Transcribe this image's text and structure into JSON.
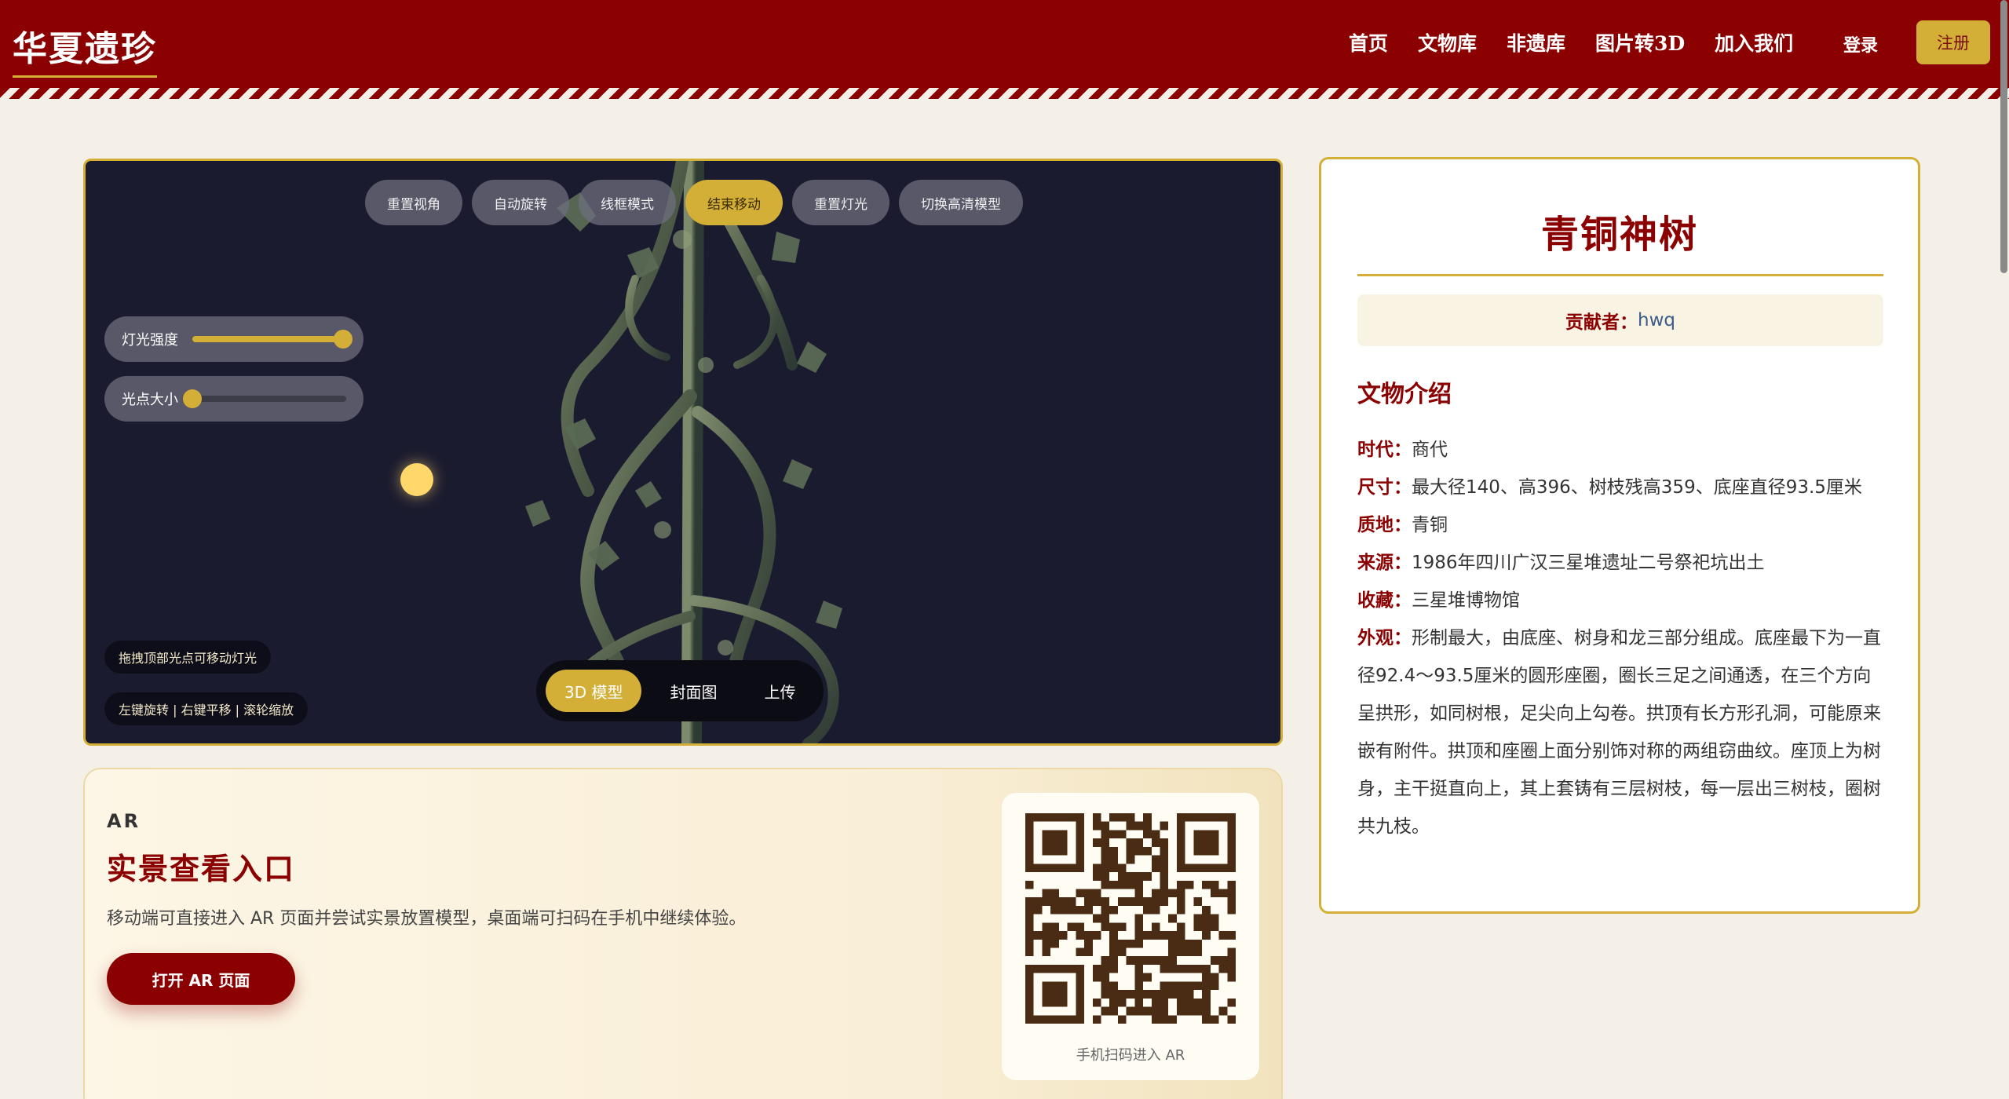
{
  "header": {
    "logo": "华夏遗珍",
    "nav": [
      "首页",
      "文物库",
      "非遗库",
      "图片转3D",
      "加入我们"
    ],
    "login": "登录",
    "register": "注册"
  },
  "viewer": {
    "toolbar": [
      "重置视角",
      "自动旋转",
      "线框模式",
      "结束移动",
      "重置灯光",
      "切换高清模型"
    ],
    "active_tool": "结束移动",
    "sliders": [
      {
        "label": "灯光强度",
        "value": 0.98
      },
      {
        "label": "光点大小",
        "value": 0.0
      }
    ],
    "hints": [
      "拖拽顶部光点可移动灯光",
      "左键旋转 | 右键平移 | 滚轮缩放"
    ],
    "tabs": [
      "3D 模型",
      "封面图",
      "上传"
    ],
    "active_tab": "3D 模型"
  },
  "ar": {
    "tag": "AR",
    "title": "实景查看入口",
    "description": "移动端可直接进入 AR 页面并尝试实景放置模型，桌面端可扫码在手机中继续体验。",
    "button": "打开 AR 页面",
    "qr_caption": "手机扫码进入 AR"
  },
  "info": {
    "title": "青铜神树",
    "contributor_label": "贡献者：",
    "contributor": "hwq",
    "section_title": "文物介绍",
    "fields": [
      {
        "label": "时代：",
        "value": "商代"
      },
      {
        "label": "尺寸：",
        "value": "最大径140、高396、树枝残高359、底座直径93.5厘米"
      },
      {
        "label": "质地：",
        "value": "青铜"
      },
      {
        "label": "来源：",
        "value": "1986年四川广汉三星堆遗址二号祭祀坑出土"
      },
      {
        "label": "收藏：",
        "value": "三星堆博物馆"
      },
      {
        "label": "外观：",
        "value": "形制最大，由底座、树身和龙三部分组成。底座最下为一直径92.4～93.5厘米的圆形座圈，圈长三足之间通透，在三个方向呈拱形，如同树根，足尖向上勾卷。拱顶有长方形孔洞，可能原来嵌有附件。拱顶和座圈上面分别饰对称的两组窃曲纹。座顶上为树身，主干挺直向上，其上套铸有三层树枝，每一层出三树枝，圈树共九枝。"
      }
    ]
  },
  "colors": {
    "brand_red": "#8b0000",
    "gold": "#d4af37",
    "viewer_bg": "#1b1b2f",
    "page_bg": "#f4f0e8"
  }
}
